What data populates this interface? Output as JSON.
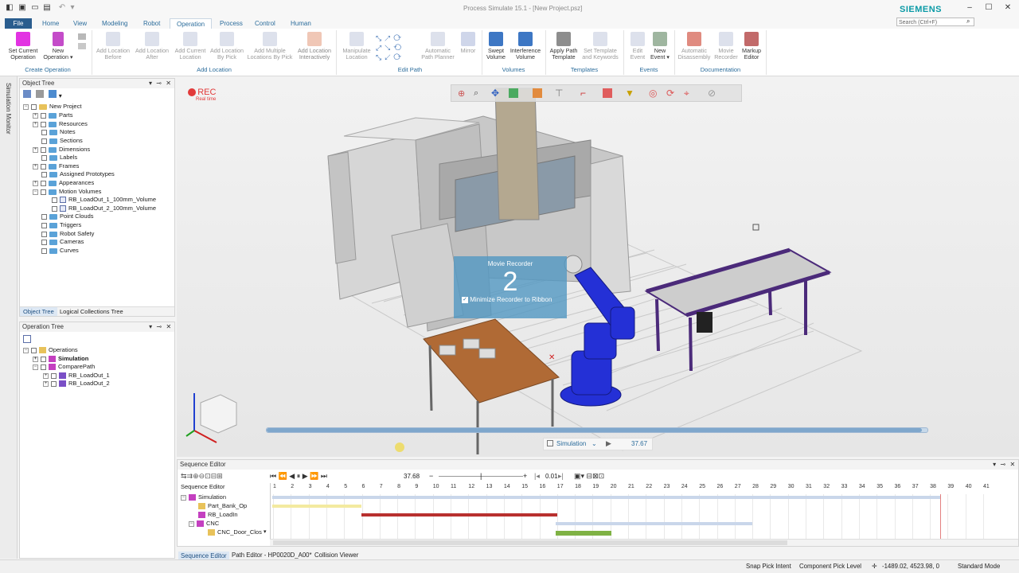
{
  "app": {
    "title": "Process Simulate 15.1 - [New Project.psz]",
    "brand": "SIEMENS",
    "search_placeholder": "Search (Ctrl+F)"
  },
  "ribbon_tabs": [
    "File",
    "Home",
    "View",
    "Modeling",
    "Robot",
    "Operation",
    "Process",
    "Control",
    "Human"
  ],
  "ribbon": {
    "create_operation": {
      "group": "Create Operation",
      "set_current": "Set Current Operation",
      "new_operation": "New Operation"
    },
    "add_location": {
      "group": "Add Location",
      "before": "Add Location Before",
      "after": "Add Location After",
      "current": "Add Current Location",
      "by_pick": "Add Location By Pick",
      "multiple": "Add Multiple Locations By Pick",
      "interactively": "Add Location Interactively"
    },
    "edit_path": {
      "group": "Edit Path",
      "manipulate": "Manipulate Location",
      "planner": "Automatic Path Planner",
      "mirror": "Mirror"
    },
    "volumes": {
      "group": "Volumes",
      "swept": "Swept Volume",
      "interference": "Interference Volume"
    },
    "templates": {
      "group": "Templates",
      "apply": "Apply Path Template",
      "set": "Set Template and Keywords"
    },
    "events": {
      "group": "Events",
      "edit": "Edit Event",
      "new": "New Event"
    },
    "documentation": {
      "group": "Documentation",
      "disassembly": "Automatic Disassembly",
      "movie": "Movie Recorder",
      "markup": "Markup Editor"
    }
  },
  "side_strip": "Simulation Monitor",
  "object_tree": {
    "title": "Object Tree",
    "root": "New Project",
    "items": [
      "Parts",
      "Resources",
      "Notes",
      "Sections",
      "Dimensions",
      "Labels",
      "Frames",
      "Assigned Prototypes",
      "Appearances",
      "Motion Volumes",
      "RB_LoadOut_1_100mm_Volume",
      "RB_LoadOut_2_100mm_Volume",
      "Point Clouds",
      "Triggers",
      "Robot Safety",
      "Cameras",
      "Curves"
    ],
    "tabs": [
      "Object Tree",
      "Logical Collections Tree"
    ]
  },
  "operation_tree": {
    "title": "Operation Tree",
    "items": [
      "Operations",
      "Simulation",
      "ComparePath",
      "RB_LoadOut_1",
      "RB_LoadOut_2"
    ]
  },
  "viewport": {
    "rec": "REC",
    "rec_sub": "Real time",
    "recorder_title": "Movie Recorder",
    "countdown": "2",
    "minimize_label": "Minimize Recorder to Ribbon",
    "sim_label": "Simulation",
    "sim_time": "37.67"
  },
  "sequence_editor": {
    "title": "Sequence Editor",
    "time": "37.68",
    "step": "0.01",
    "col_header": "Sequence Editor",
    "rows": [
      "Simulation",
      "Part_Bank_Op",
      "RB_LoadIn",
      "CNC",
      "CNC_Door_Clos"
    ],
    "ticks": [
      "1",
      "2",
      "3",
      "4",
      "5",
      "6",
      "7",
      "8",
      "9",
      "10",
      "11",
      "12",
      "13",
      "14",
      "15",
      "16",
      "17",
      "18",
      "19",
      "20",
      "21",
      "22",
      "23",
      "24",
      "25",
      "26",
      "27",
      "28",
      "29",
      "30",
      "31",
      "32",
      "33",
      "34",
      "35",
      "36",
      "37",
      "38",
      "39",
      "40",
      "41"
    ]
  },
  "bottom_tabs": [
    "Sequence Editor",
    "Path Editor - HP0020D_A00*",
    "Collision Viewer"
  ],
  "status": {
    "snap": "Snap Pick Intent",
    "pick": "Component Pick Level",
    "coords": "-1489.02, 4523.98, 0",
    "mode": "Standard Mode"
  }
}
